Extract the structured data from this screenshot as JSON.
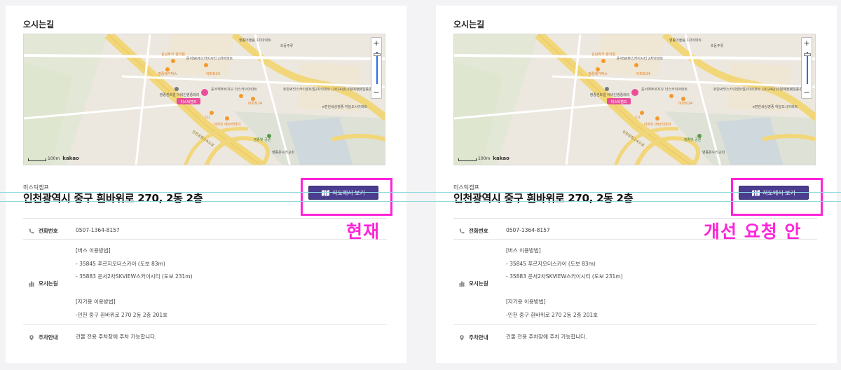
{
  "panels": [
    {
      "section_title": "오시는길",
      "map": {
        "marker_label": "미스틱캠프",
        "labels": [
          "영종어울림 1차아파트",
          "초등주류",
          "운남파크 편의점",
          "운서SK뷰스카이시티 2차아파트",
          "영종메가박스",
          "이마트24",
          "운서역푸르지오 더스카이아파트",
          "영종센트럴 아비인영종래리",
          "미스틱캠프",
          "CU",
          "이마트24",
          "이마트 에브리데이",
          "호반써밋스카이센트럴2차아파트 (2024년10월예정)",
          "제일풍경채",
          "e편한세상영종 하늘도시아파트",
          "운서역로",
          "인천공항고속도로",
          "영종하늘도시로",
          "중산로",
          "영종온누리교회",
          "영종빛 공원"
        ],
        "zoom_in": "+",
        "zoom_out": "−",
        "scale_text": "100m",
        "provider": "kakao"
      },
      "place_name": "미스틱캠프",
      "address": "인천광역시 중구 흰바위로 270, 2동 2층",
      "map_button": "지도에서 보기",
      "rows": {
        "phone_label": "전화번호",
        "phone_value": "0507-1364-8157",
        "route_label": "오시는길",
        "route_lines": [
          "[버스 이용방법]",
          "- 35845 푸르지오더스카이 (도보 83m)",
          "- 35883 운서2차SKVIEW스카이시티 (도보 231m)",
          "[자가용 이용방법]",
          "-인천 중구 흰바위로 270 2동 2층 201호"
        ],
        "parking_label": "주차안내",
        "parking_value": "건물 전용 주차장에 주차 가능합니다."
      }
    }
  ],
  "annotations": {
    "left_note": "현재",
    "right_note": "개선 요청 안"
  },
  "colors": {
    "button": "#4a3d8f",
    "highlight": "#ff24d8",
    "guide": "#8fd9e0",
    "marker": "#e94e9b"
  },
  "icons": {
    "phone": "phone-icon",
    "route": "building-icon",
    "parking": "map-pin-icon",
    "map_button": "map-icon"
  }
}
